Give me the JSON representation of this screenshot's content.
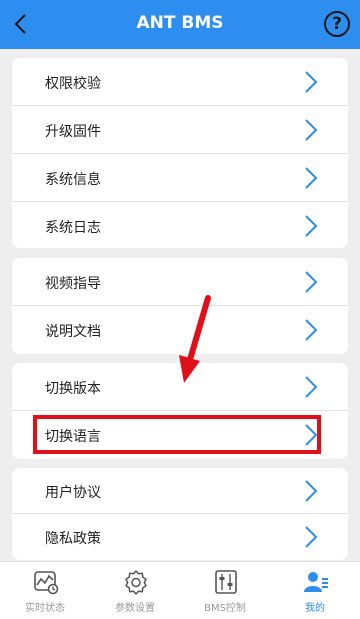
{
  "header": {
    "title": "ANT BMS",
    "help_label": "?"
  },
  "menu": {
    "group1": [
      "权限校验",
      "升级固件",
      "系统信息",
      "系统日志"
    ],
    "group2": [
      "视频指导",
      "说明文档"
    ],
    "group3": [
      "切换版本",
      "切换语言"
    ],
    "group4": [
      "用户协议",
      "隐私政策"
    ]
  },
  "tabs": [
    {
      "label": "实时状态",
      "icon": "realtime-status-icon"
    },
    {
      "label": "参数设置",
      "icon": "settings-gear-icon"
    },
    {
      "label": "BMS控制",
      "icon": "bms-control-icon"
    },
    {
      "label": "我的",
      "icon": "profile-icon"
    }
  ],
  "colors": {
    "accent": "#2d8ef0",
    "highlight": "#e0101a",
    "inactive_tab": "#999999"
  }
}
